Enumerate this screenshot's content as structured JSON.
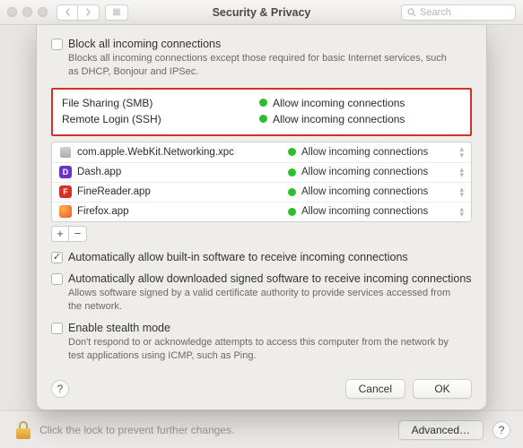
{
  "window": {
    "title": "Security & Privacy",
    "search_placeholder": "Search"
  },
  "sheet": {
    "block_all": {
      "label": "Block all incoming connections",
      "desc": "Blocks all incoming connections except those required for basic Internet services, such as DHCP, Bonjour and IPSec."
    },
    "highlight_services": [
      {
        "name": "File Sharing (SMB)",
        "status": "Allow incoming connections"
      },
      {
        "name": "Remote Login (SSH)",
        "status": "Allow incoming connections"
      }
    ],
    "apps": [
      {
        "icon": "xpc",
        "name": "com.apple.WebKit.Networking.xpc",
        "status": "Allow incoming connections"
      },
      {
        "icon": "dash",
        "name": "Dash.app",
        "status": "Allow incoming connections"
      },
      {
        "icon": "finereader",
        "name": "FineReader.app",
        "status": "Allow incoming connections"
      },
      {
        "icon": "firefox",
        "name": "Firefox.app",
        "status": "Allow incoming connections"
      }
    ],
    "add_label": "+",
    "remove_label": "−",
    "auto_builtin": {
      "label": "Automatically allow built-in software to receive incoming connections"
    },
    "auto_signed": {
      "label": "Automatically allow downloaded signed software to receive incoming connections",
      "desc": "Allows software signed by a valid certificate authority to provide services accessed from the network."
    },
    "stealth": {
      "label": "Enable stealth mode",
      "desc": "Don't respond to or acknowledge attempts to access this computer from the network by test applications using ICMP, such as Ping."
    },
    "help_label": "?",
    "cancel_label": "Cancel",
    "ok_label": "OK"
  },
  "footer": {
    "lock_text": "Click the lock to prevent further changes.",
    "advanced_label": "Advanced…",
    "help_label": "?"
  }
}
